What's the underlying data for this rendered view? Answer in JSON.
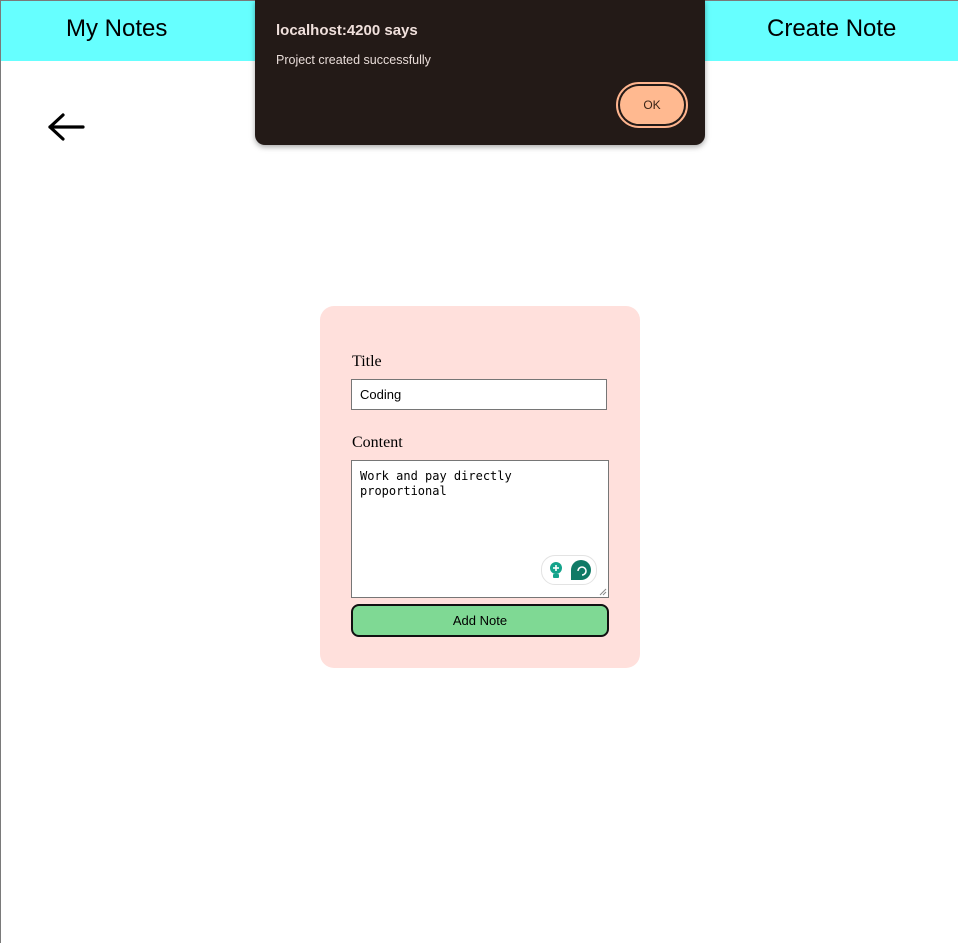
{
  "navbar": {
    "my_notes": "My Notes",
    "create_note": "Create Note",
    "bg_color": "#66ffff"
  },
  "icons": {
    "back": "arrow-left-icon",
    "extension_bulb": "lightbulb-icon",
    "extension_logo": "assistant-logo-icon"
  },
  "form": {
    "title_label": "Title",
    "title_value": "Coding",
    "content_label": "Content",
    "content_value": "Work and pay directly\nproportional",
    "submit_label": "Add Note",
    "card_color": "#ffe0dc",
    "button_color": "#7fd994"
  },
  "dialog": {
    "title": "localhost:4200 says",
    "message": "Project created successfully",
    "ok_label": "OK",
    "bg_color": "#231a17",
    "ok_color": "#ffb990"
  }
}
